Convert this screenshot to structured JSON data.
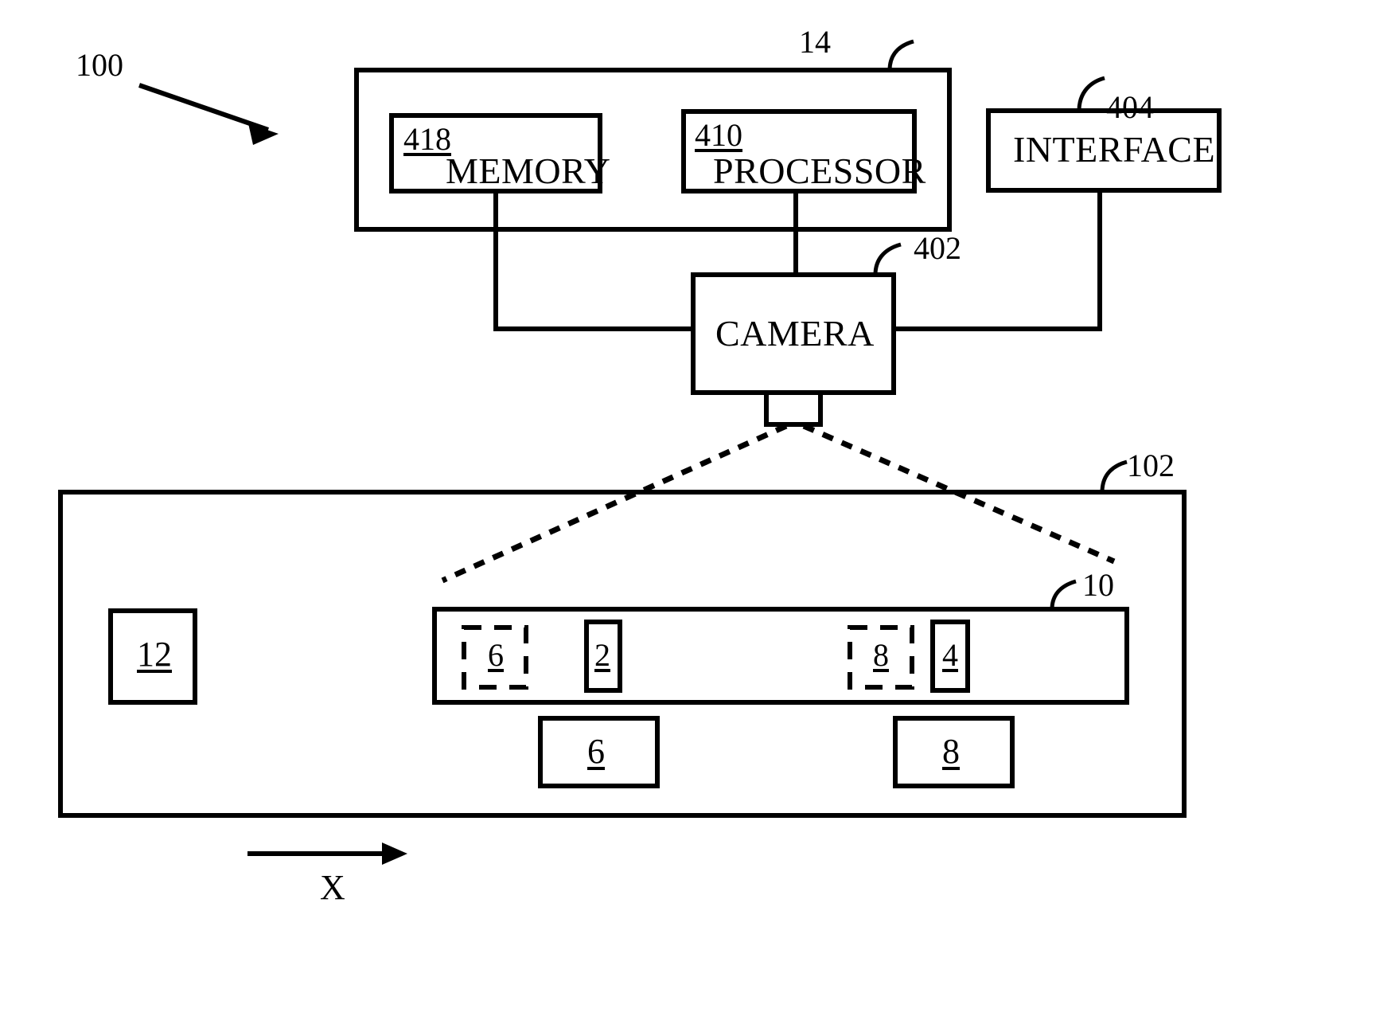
{
  "figure": {
    "system_label": "100",
    "axis_label": "X"
  },
  "callouts": {
    "system_enclosure": "14",
    "interface": "404",
    "camera": "402",
    "scene": "102",
    "belt": "10"
  },
  "blocks": {
    "memory": {
      "numeral": "418",
      "caption": "MEMORY"
    },
    "processor": {
      "numeral": "410",
      "caption": "PROCESSOR"
    },
    "interface": {
      "caption": "INTERFACE"
    },
    "camera": {
      "caption": "CAMERA"
    }
  },
  "scene_items": {
    "station": {
      "numeral": "12"
    },
    "belt_objects": [
      {
        "numeral": "6",
        "border": "dashed"
      },
      {
        "numeral": "2",
        "border": "solid"
      },
      {
        "numeral": "8",
        "border": "dashed"
      },
      {
        "numeral": "4",
        "border": "solid"
      }
    ],
    "lower_objects": [
      {
        "numeral": "6"
      },
      {
        "numeral": "8"
      }
    ]
  },
  "colors": {
    "ink": "#000000",
    "paper": "#ffffff"
  }
}
